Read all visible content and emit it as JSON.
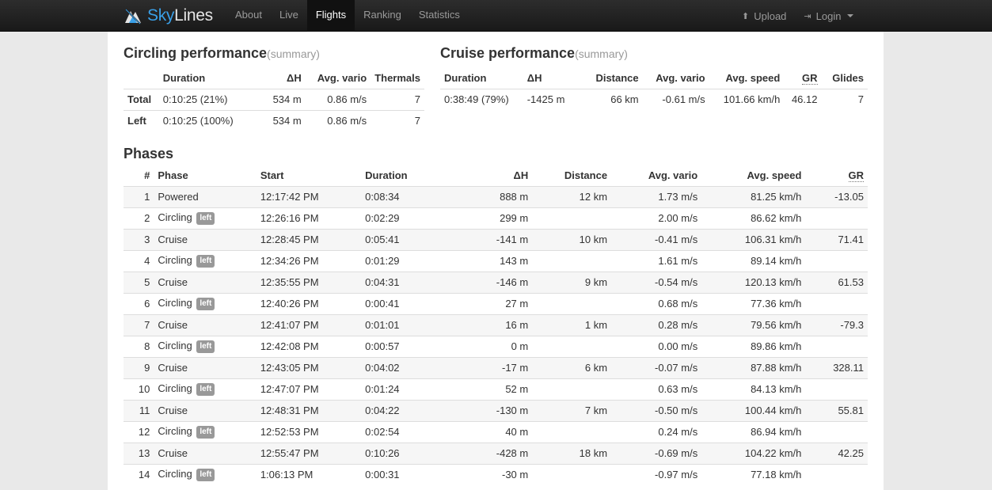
{
  "nav": {
    "brand_sky": "Sky",
    "brand_lines": "Lines",
    "items": [
      "About",
      "Live",
      "Flights",
      "Ranking",
      "Statistics"
    ],
    "active": "Flights",
    "upload": "Upload",
    "login": "Login"
  },
  "circling": {
    "title": "Circling performance",
    "subtitle": "(summary)",
    "headers": [
      "",
      "Duration",
      "ΔH",
      "Avg. vario",
      "Thermals"
    ],
    "rows": [
      [
        "Total",
        "0:10:25 (21%)",
        "534 m",
        "0.86 m/s",
        "7"
      ],
      [
        "Left",
        "0:10:25 (100%)",
        "534 m",
        "0.86 m/s",
        "7"
      ]
    ]
  },
  "cruise": {
    "title": "Cruise performance",
    "subtitle": "(summary)",
    "headers": [
      "Duration",
      "ΔH",
      "Distance",
      "Avg. vario",
      "Avg. speed",
      "GR",
      "Glides"
    ],
    "rows": [
      [
        "0:38:49 (79%)",
        "-1425 m",
        "66 km",
        "-0.61 m/s",
        "101.66 km/h",
        "46.12",
        "7"
      ]
    ]
  },
  "phases": {
    "title": "Phases",
    "headers": [
      "#",
      "Phase",
      "Start",
      "Duration",
      "ΔH",
      "Distance",
      "Avg. vario",
      "Avg. speed",
      "GR"
    ],
    "badge": "left",
    "rows": [
      [
        "1",
        "Powered",
        false,
        "12:17:42 PM",
        "0:08:34",
        "888 m",
        "12 km",
        "1.73 m/s",
        "81.25 km/h",
        "-13.05"
      ],
      [
        "2",
        "Circling",
        true,
        "12:26:16 PM",
        "0:02:29",
        "299 m",
        "",
        "2.00 m/s",
        "86.62 km/h",
        ""
      ],
      [
        "3",
        "Cruise",
        false,
        "12:28:45 PM",
        "0:05:41",
        "-141 m",
        "10 km",
        "-0.41 m/s",
        "106.31 km/h",
        "71.41"
      ],
      [
        "4",
        "Circling",
        true,
        "12:34:26 PM",
        "0:01:29",
        "143 m",
        "",
        "1.61 m/s",
        "89.14 km/h",
        ""
      ],
      [
        "5",
        "Cruise",
        false,
        "12:35:55 PM",
        "0:04:31",
        "-146 m",
        "9 km",
        "-0.54 m/s",
        "120.13 km/h",
        "61.53"
      ],
      [
        "6",
        "Circling",
        true,
        "12:40:26 PM",
        "0:00:41",
        "27 m",
        "",
        "0.68 m/s",
        "77.36 km/h",
        ""
      ],
      [
        "7",
        "Cruise",
        false,
        "12:41:07 PM",
        "0:01:01",
        "16 m",
        "1 km",
        "0.28 m/s",
        "79.56 km/h",
        "-79.3"
      ],
      [
        "8",
        "Circling",
        true,
        "12:42:08 PM",
        "0:00:57",
        "0 m",
        "",
        "0.00 m/s",
        "89.86 km/h",
        ""
      ],
      [
        "9",
        "Cruise",
        false,
        "12:43:05 PM",
        "0:04:02",
        "-17 m",
        "6 km",
        "-0.07 m/s",
        "87.88 km/h",
        "328.11"
      ],
      [
        "10",
        "Circling",
        true,
        "12:47:07 PM",
        "0:01:24",
        "52 m",
        "",
        "0.63 m/s",
        "84.13 km/h",
        ""
      ],
      [
        "11",
        "Cruise",
        false,
        "12:48:31 PM",
        "0:04:22",
        "-130 m",
        "7 km",
        "-0.50 m/s",
        "100.44 km/h",
        "55.81"
      ],
      [
        "12",
        "Circling",
        true,
        "12:52:53 PM",
        "0:02:54",
        "40 m",
        "",
        "0.24 m/s",
        "86.94 km/h",
        ""
      ],
      [
        "13",
        "Cruise",
        false,
        "12:55:47 PM",
        "0:10:26",
        "-428 m",
        "18 km",
        "-0.69 m/s",
        "104.22 km/h",
        "42.25"
      ],
      [
        "14",
        "Circling",
        true,
        "1:06:13 PM",
        "0:00:31",
        "-30 m",
        "",
        "-0.97 m/s",
        "77.18 km/h",
        ""
      ]
    ]
  },
  "colors": {
    "navbar": "#1f1f1f",
    "brand_accent": "#3aa0e8",
    "badge": "#999999",
    "stripe": "#f6f6f6"
  }
}
